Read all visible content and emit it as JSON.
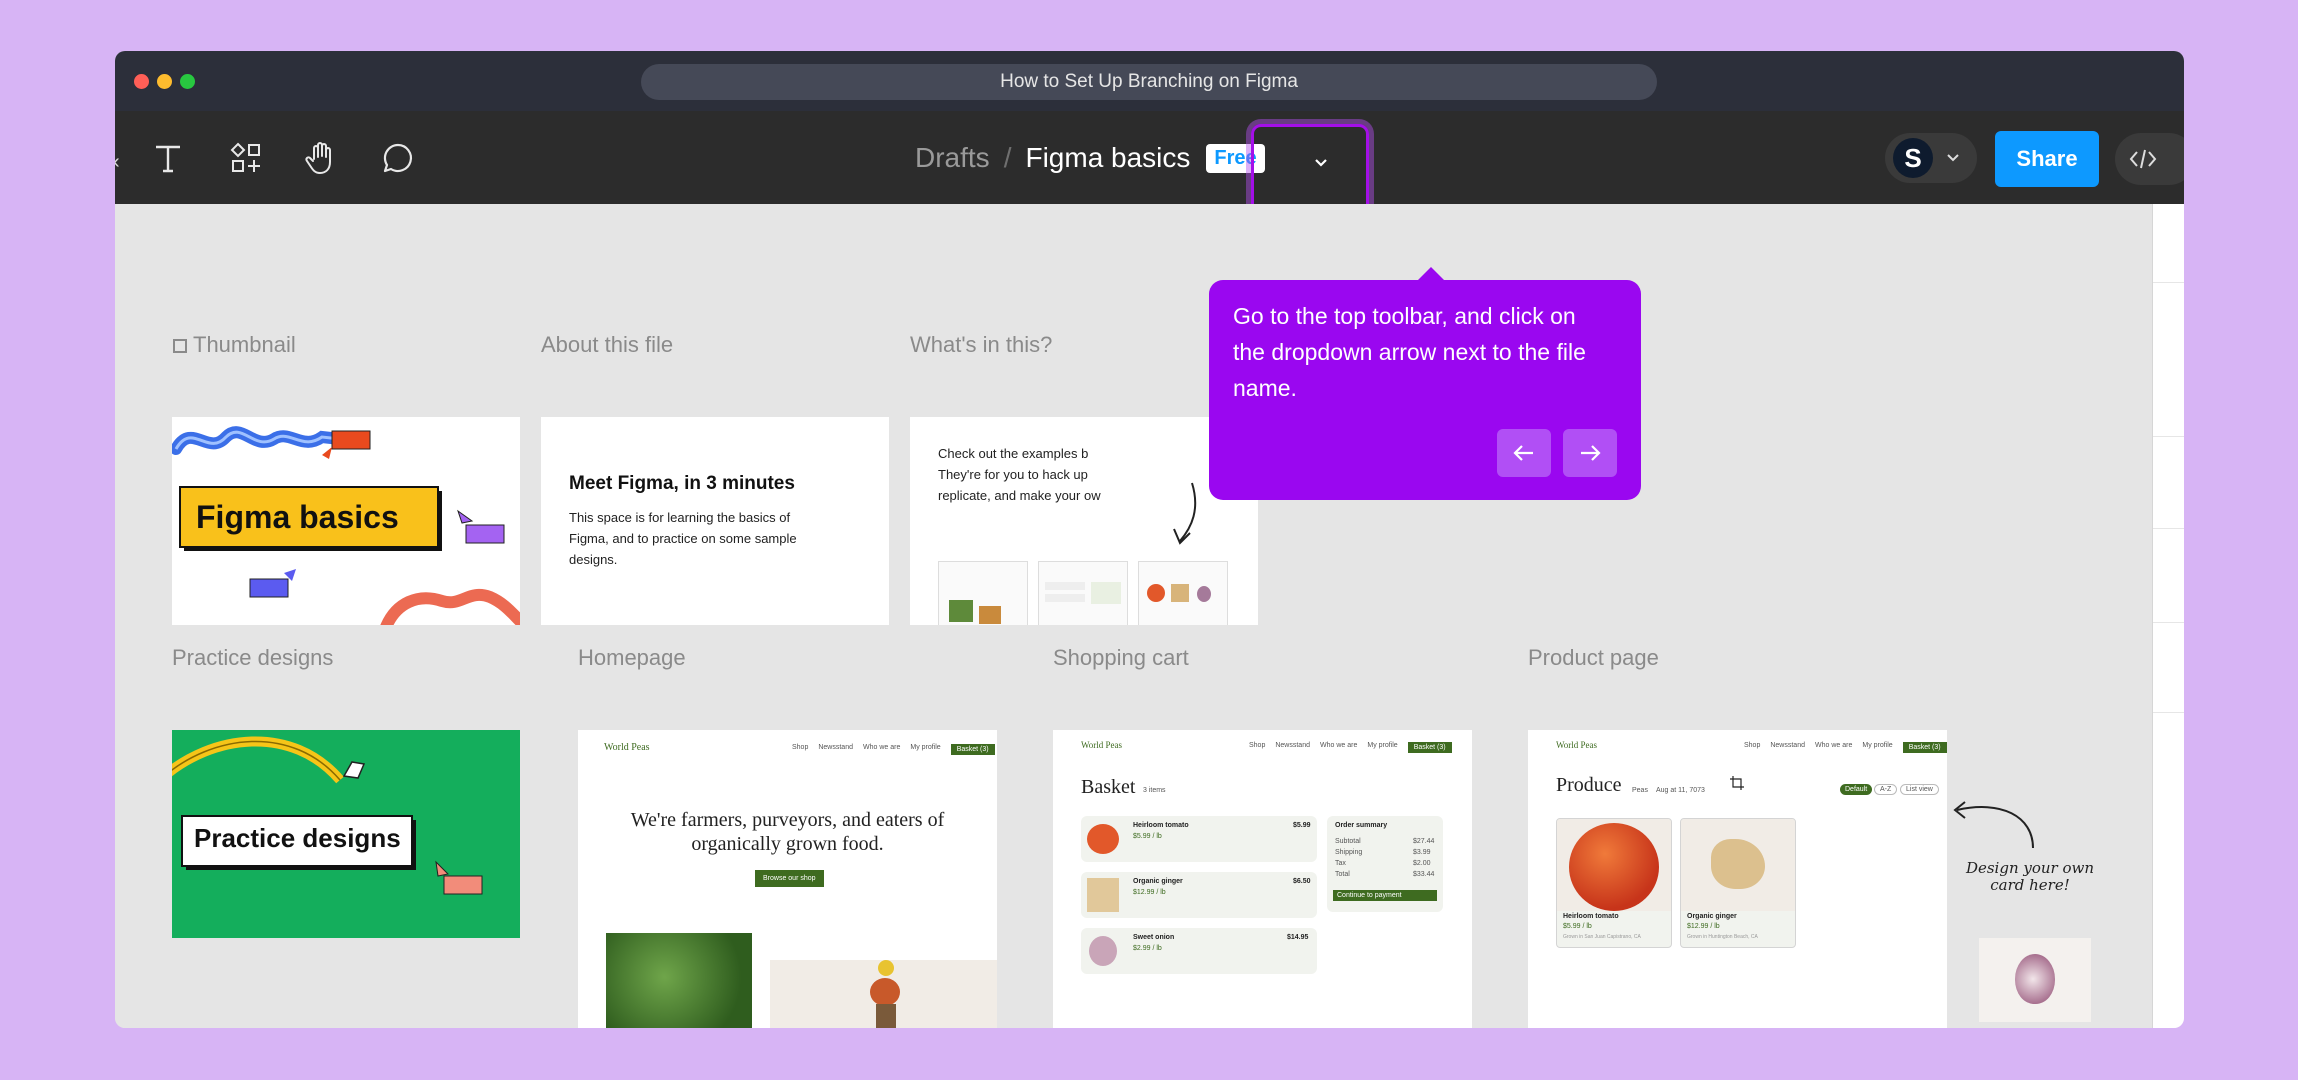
{
  "window": {
    "title": "How to Set Up Branching on Figma"
  },
  "toolbar": {
    "breadcrumb_parent": "Drafts",
    "breadcrumb_separator": "/",
    "file_name": "Figma basics",
    "plan_badge": "Free",
    "avatar_initial": "S",
    "share_label": "Share",
    "tools": [
      "text-tool",
      "resources-tool",
      "hand-tool",
      "comment-tool"
    ]
  },
  "tooltip": {
    "message": "Go to the top toolbar, and click on the dropdown arrow next to the file name."
  },
  "canvas": {
    "frames": {
      "thumbnail": {
        "label": "Thumbnail",
        "title": "Figma basics"
      },
      "about": {
        "label": "About this file",
        "heading": "Meet Figma, in 3 minutes",
        "body": "This space is for learning the basics of Figma, and to practice on some sample designs."
      },
      "whats_in": {
        "label": "What's in this?",
        "body": "Check out the examples b They're for you to hack up replicate, and make your ow"
      },
      "practice": {
        "label": "Practice designs",
        "title": "Practice designs"
      },
      "homepage": {
        "label": "Homepage",
        "brand": "World Peas",
        "headline_1": "We're farmers, purveyors, and eaters of",
        "headline_2": "organically grown food.",
        "cta": "Browse our shop"
      },
      "cart": {
        "label": "Shopping cart",
        "brand": "World Peas",
        "heading": "Basket",
        "count": "3 items",
        "items": [
          {
            "name": "Heirloom tomato",
            "price": "$5.99 / lb",
            "total": "$5.99"
          },
          {
            "name": "Organic ginger",
            "price": "$12.99 / lb",
            "total": "$6.50"
          },
          {
            "name": "Sweet onion",
            "price": "$2.99 / lb",
            "total": "$14.95"
          }
        ],
        "summary_title": "Order summary",
        "summary_rows": [
          [
            "Subtotal",
            "$27.44"
          ],
          [
            "Shipping",
            "$3.99"
          ],
          [
            "Tax",
            "$2.00"
          ],
          [
            "Total",
            "$33.44"
          ]
        ],
        "checkout": "Continue to payment"
      },
      "product": {
        "label": "Product page",
        "brand": "World Peas",
        "heading": "Produce",
        "sub": "Peas",
        "date": "Aug at 11, 7073",
        "filters": [
          "Default",
          "A-Z",
          "List view"
        ],
        "cards": [
          {
            "name": "Heirloom tomato",
            "price": "$5.99 / lb",
            "origin": "Grown in San Juan Capistrano, CA"
          },
          {
            "name": "Organic ginger",
            "price": "$12.99 / lb",
            "origin": "Grown in Huntington Beach, CA"
          }
        ]
      },
      "nav_items": [
        "Shop",
        "Newsstand",
        "Who we are",
        "My profile",
        "Basket (3)"
      ]
    },
    "annotation": "Design your own card here!"
  },
  "colors": {
    "accent": "#9a07f0",
    "share": "#0d99ff",
    "bg": "#d7b4f5"
  }
}
